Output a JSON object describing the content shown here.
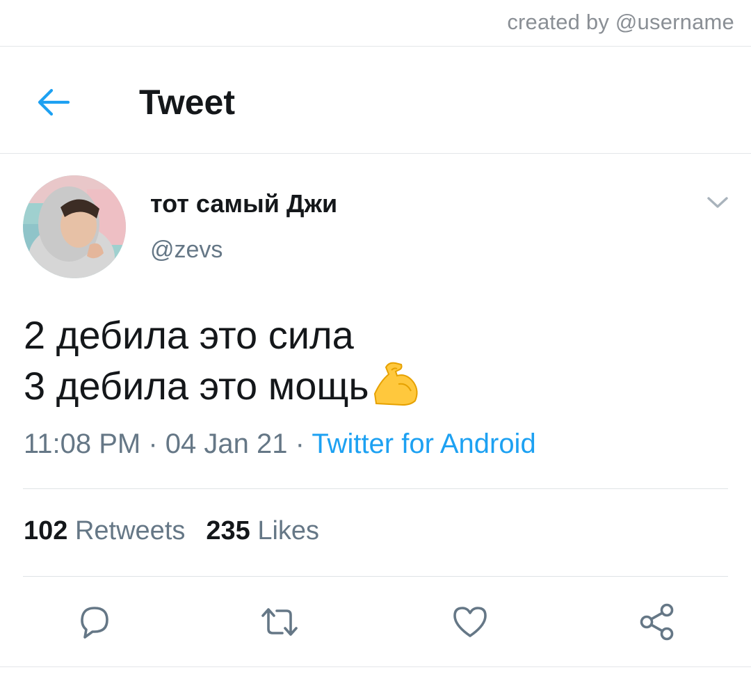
{
  "watermark": "created by @username",
  "header": {
    "title": "Tweet",
    "back_icon": "arrow-left-icon"
  },
  "tweet": {
    "author": {
      "display_name": "тот самый Джи",
      "handle": "@zevs"
    },
    "lines": [
      "2 дебила это сила",
      "3 дебила это мощь"
    ],
    "emoji": "flexed-biceps-icon",
    "time": "11:08 PM",
    "date": "04 Jan 21",
    "separator": " · ",
    "source": "Twitter for Android",
    "stats": {
      "retweets_count": "102",
      "retweets_label": "Retweets",
      "likes_count": "235",
      "likes_label": "Likes"
    }
  },
  "actions": [
    "reply-icon",
    "retweet-icon",
    "like-icon",
    "share-icon"
  ],
  "colors": {
    "accent": "#1da1f2",
    "text": "#14171a",
    "secondary": "#657786",
    "divider": "#e3e6e9"
  }
}
